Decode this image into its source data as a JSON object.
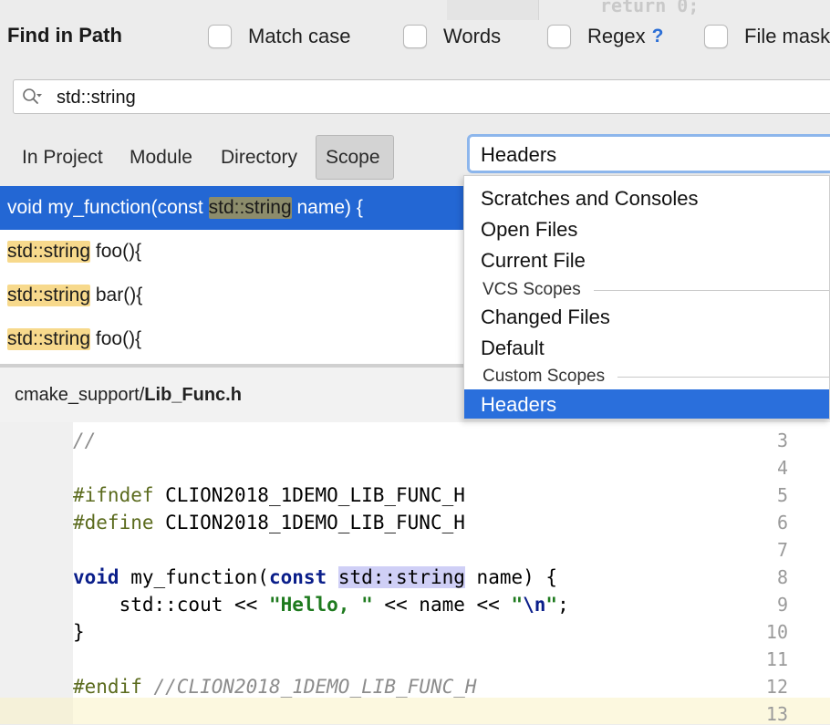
{
  "background_code": "return 0;",
  "header": {
    "title": "Find in Path",
    "options": [
      {
        "label": "Match case",
        "checked": false
      },
      {
        "label": "Words",
        "checked": false
      },
      {
        "label": "Regex",
        "checked": false,
        "help": "?"
      },
      {
        "label": "File mask",
        "checked": false
      }
    ]
  },
  "search": {
    "value": "std::string",
    "icon": "search-icon"
  },
  "scopes": {
    "tabs": [
      {
        "label": "In Project",
        "active": false
      },
      {
        "label": "Module",
        "active": false
      },
      {
        "label": "Directory",
        "active": false
      },
      {
        "label": "Scope",
        "active": true
      }
    ],
    "selected": "Headers"
  },
  "dropdown": {
    "items": [
      {
        "type": "item",
        "label": "Scratches and Consoles"
      },
      {
        "type": "item",
        "label": "Open Files"
      },
      {
        "type": "item",
        "label": "Current File"
      },
      {
        "type": "group",
        "label": "VCS Scopes"
      },
      {
        "type": "item",
        "label": "Changed Files"
      },
      {
        "type": "item",
        "label": "Default"
      },
      {
        "type": "group",
        "label": "Custom Scopes"
      },
      {
        "type": "item",
        "label": "Headers",
        "selected": true
      }
    ]
  },
  "results": [
    {
      "pre": "void my_function(const ",
      "match": "std::string",
      "post": " name) {",
      "selected": true
    },
    {
      "pre": "",
      "match": "std::string",
      "post": " foo(){",
      "selected": false
    },
    {
      "pre": "",
      "match": "std::string",
      "post": " bar(){",
      "selected": false
    },
    {
      "pre": "",
      "match": "std::string",
      "post": " foo(){",
      "selected": false
    }
  ],
  "preview": {
    "path_dir": "cmake_support/",
    "path_file": "Lib_Func.h",
    "lines": [
      {
        "num": "3",
        "code": "//"
      },
      {
        "num": "4",
        "code": ""
      },
      {
        "num": "5",
        "code": "#ifndef CLION2018_1DEMO_LIB_FUNC_H"
      },
      {
        "num": "6",
        "code": "#define CLION2018_1DEMO_LIB_FUNC_H"
      },
      {
        "num": "7",
        "code": ""
      },
      {
        "num": "8",
        "code": "void my_function(const std::string name) {"
      },
      {
        "num": "9",
        "code": "    std::cout << \"Hello, \" << name << \"\\n\";"
      },
      {
        "num": "10",
        "code": "}"
      },
      {
        "num": "11",
        "code": ""
      },
      {
        "num": "12",
        "code": "#endif //CLION2018_1DEMO_LIB_FUNC_H"
      },
      {
        "num": "13",
        "code": ""
      }
    ]
  }
}
